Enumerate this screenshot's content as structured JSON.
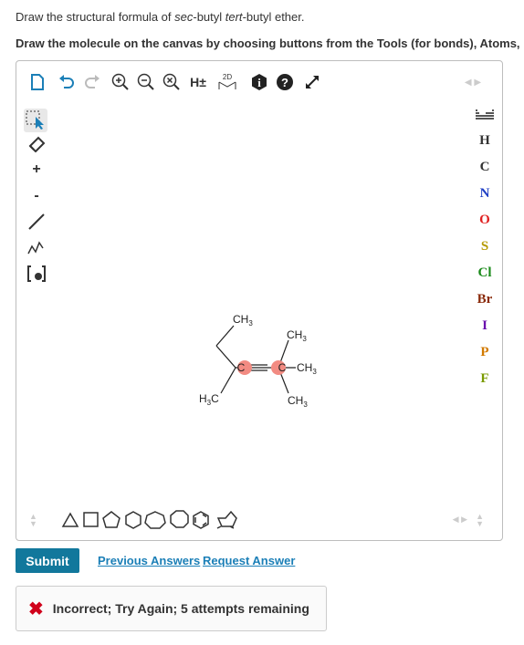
{
  "question": {
    "prefix": "Draw the structural formula of ",
    "sec": "sec",
    "mid": "-butyl ",
    "tert": "tert",
    "suffix": "-butyl ether.",
    "instruction": "Draw the molecule on the canvas by choosing buttons from the Tools (for bonds), Atoms,"
  },
  "toolbar": {
    "hydrogen_label": "H±",
    "twod_label": "2D"
  },
  "atoms": [
    "H",
    "C",
    "N",
    "O",
    "S",
    "Cl",
    "Br",
    "I",
    "P",
    "F"
  ],
  "atom_colors": {
    "H": "#333333",
    "C": "#222222",
    "N": "#1f3fc4",
    "O": "#e02020",
    "S": "#b59a00",
    "Cl": "#1a8a1a",
    "Br": "#8a2a0a",
    "I": "#6a0dad",
    "P": "#d27a00",
    "F": "#7a9a00"
  },
  "molecule": {
    "ch3_top": "CH",
    "ch3_right_top": "CH",
    "ch3_right": "CH",
    "ch3_right_bottom": "CH",
    "h3c": "H",
    "h3c_c": "C",
    "c1": "C",
    "c2": "C",
    "sub3": "3"
  },
  "actions": {
    "submit": "Submit",
    "previous_answers": "Previous Answers",
    "request_answer": "Request Answer"
  },
  "feedback": {
    "text": "Incorrect; Try Again; 5 attempts remaining"
  }
}
